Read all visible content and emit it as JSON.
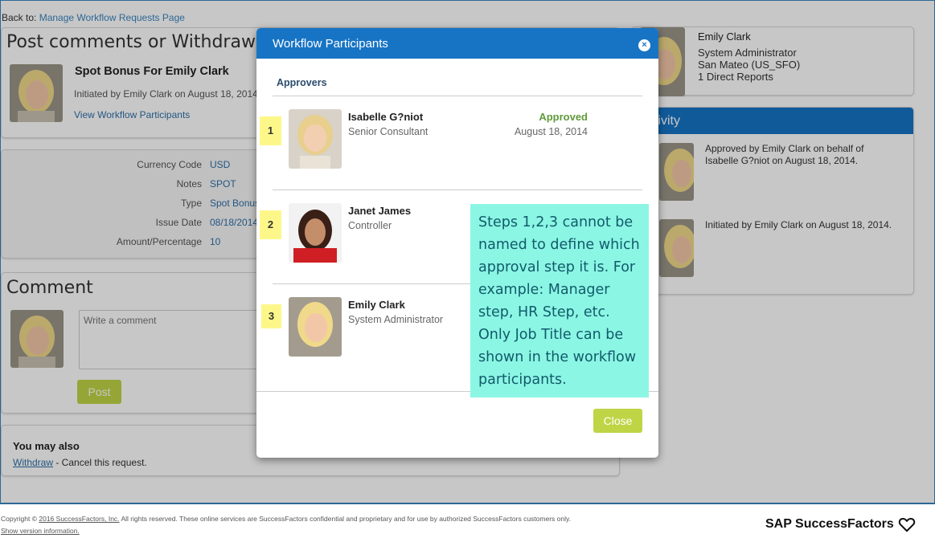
{
  "back": {
    "prefix": "Back to:",
    "link": "Manage Workflow Requests Page"
  },
  "post_card": {
    "title": "Post comments or Withdraw re",
    "request_title": "Spot Bonus For Emily Clark",
    "initiated": "Initiated by Emily Clark on August 18, 2014",
    "view_link": "View Workflow Participants"
  },
  "details": [
    {
      "label": "Currency Code",
      "value": "USD"
    },
    {
      "label": "Notes",
      "value": "SPOT"
    },
    {
      "label": "Type",
      "value": "Spot Bonus"
    },
    {
      "label": "Issue Date",
      "value": "08/18/2014"
    },
    {
      "label": "Amount/Percentage",
      "value": "10"
    }
  ],
  "comment": {
    "title": "Comment",
    "placeholder": "Write a comment",
    "post_label": "Post"
  },
  "also": {
    "title": "You may also",
    "withdraw_link": "Withdraw",
    "withdraw_text": " - Cancel this request."
  },
  "profile": {
    "name": "Emily Clark",
    "role": "System Administrator",
    "location": "San Mateo (US_SFO)",
    "reports": "1 Direct Reports"
  },
  "activity": {
    "title": "tivity",
    "items": [
      "Approved by Emily Clark on behalf of Isabelle G?niot on August 18, 2014.",
      "Initiated by Emily Clark on August 18, 2014."
    ]
  },
  "modal": {
    "title": "Workflow Participants",
    "close_icon": "×",
    "section": "Approvers",
    "participants": [
      {
        "step": "1",
        "name": "Isabelle G?niot",
        "title": "Senior Consultant",
        "status": "Approved",
        "date": "August 18, 2014"
      },
      {
        "step": "2",
        "name": "Janet James",
        "title": "Controller",
        "status": "",
        "date": ""
      },
      {
        "step": "3",
        "name": "Emily Clark",
        "title": "System Administrator",
        "status": "",
        "date": ""
      }
    ],
    "close_label": "Close"
  },
  "annotation": "Steps 1,2,3 cannot be named to define which approval step it is. For example: Manager step, HR Step, etc. Only Job Title can be shown in the workflow participants.",
  "footer": {
    "copyright_prefix": "Copyright © ",
    "copyright_link": "2016 SuccessFactors, Inc.",
    "copyright_suffix": " All rights reserved. These online services are SuccessFactors confidential and proprietary and for use by authorized SuccessFactors customers only.",
    "show_version": "Show version information.",
    "brand": "SAP SuccessFactors",
    "brand_icon": "heart-icon"
  },
  "colors": {
    "header_blue": "#1774c5",
    "link_blue": "#2d6fa8",
    "button_green": "#bfd546",
    "approved_green": "#5f9a3a",
    "step_yellow": "#fdf78a",
    "note_cyan": "#8cf6e4"
  }
}
